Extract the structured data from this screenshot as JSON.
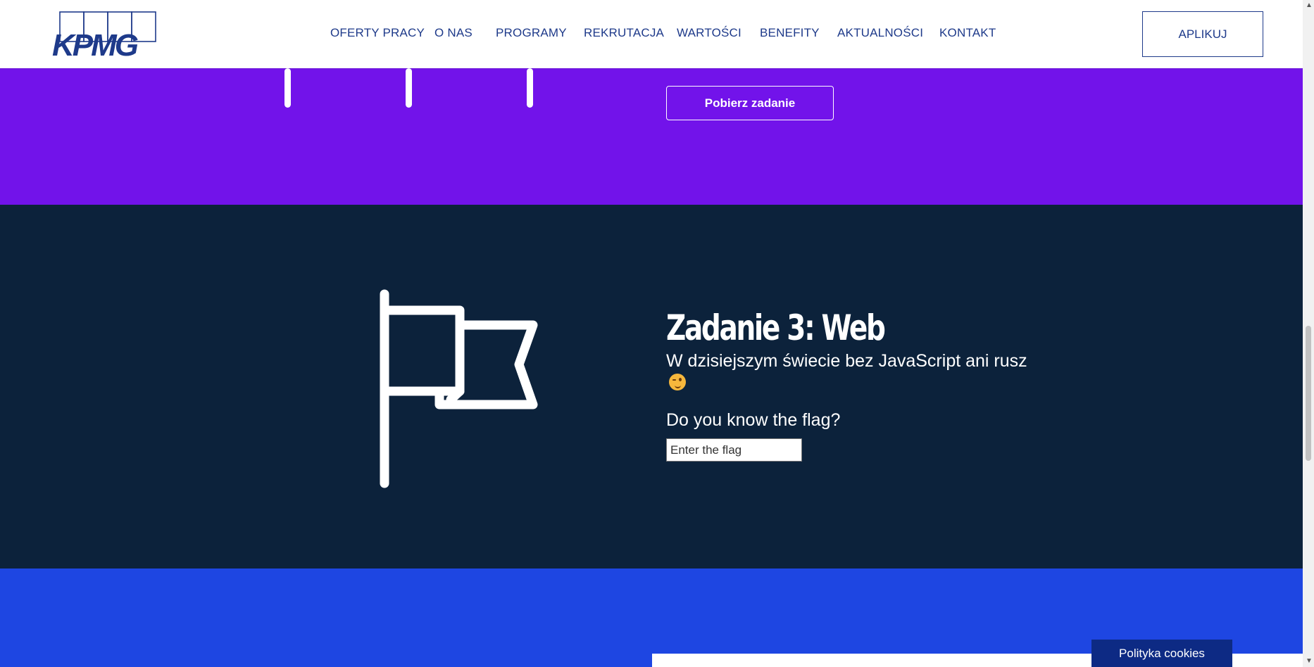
{
  "header": {
    "logo_text": "KPMG",
    "nav": [
      {
        "label": "OFERTY PRACY"
      },
      {
        "label": "O NAS"
      },
      {
        "label": "PROGRAMY"
      },
      {
        "label": "REKRUTACJA"
      },
      {
        "label": "WARTOŚCI"
      },
      {
        "label": "BENEFITY"
      },
      {
        "label": "AKTUALNOŚCI"
      },
      {
        "label": "KONTAKT"
      }
    ],
    "apply_label": "APLIKUJ"
  },
  "task_prev": {
    "download_label": "Pobierz zadanie"
  },
  "task3": {
    "title": "Zadanie 3: Web",
    "description": "W dzisiejszym świecie bez JavaScript ani rusz",
    "emoji": "winking-face",
    "question": "Do you know the flag?",
    "input_placeholder": "Enter the flag",
    "input_value": ""
  },
  "footer": {
    "cookies_label": "Polityka cookies"
  },
  "colors": {
    "brand_blue": "#1e3a8a",
    "purple": "#7213ea",
    "dark_navy": "#0c223b",
    "blue": "#1e46e2",
    "cookies_bg": "#0d2a84"
  }
}
